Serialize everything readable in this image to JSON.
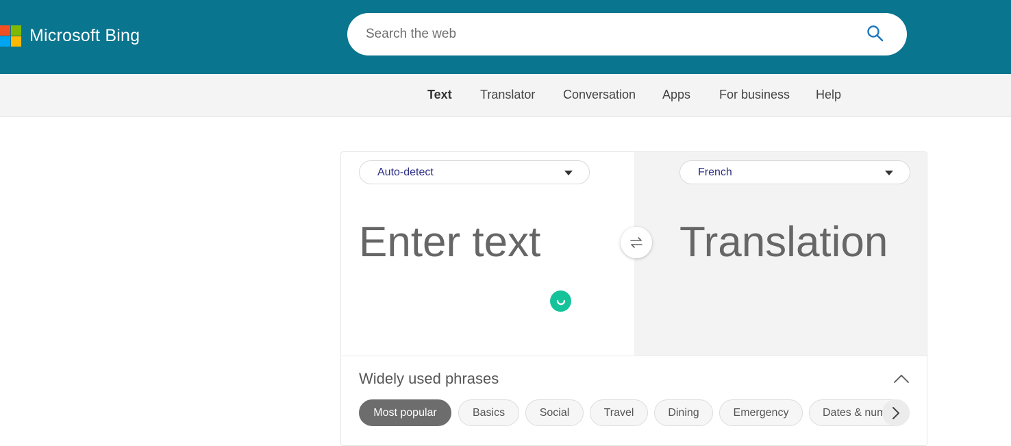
{
  "header": {
    "brand": "Microsoft Bing",
    "search": {
      "placeholder": "Search the web"
    },
    "colors": {
      "background": "#0a758f",
      "logo_red": "#f25022",
      "logo_green": "#7fba00",
      "logo_blue": "#00a4ef",
      "logo_yellow": "#ffb900"
    }
  },
  "subnav": {
    "items": [
      {
        "label": "Text",
        "active": true
      },
      {
        "label": "Translator"
      },
      {
        "label": "Conversation"
      },
      {
        "label": "Apps"
      },
      {
        "label": "For business"
      },
      {
        "label": "Help"
      }
    ]
  },
  "translator": {
    "source_language": "Auto-detect",
    "target_language": "French",
    "input_placeholder": "Enter text",
    "output_placeholder": "Translation",
    "swap_icon": "swap-arrows-icon"
  },
  "phrases": {
    "title": "Widely used phrases",
    "categories": [
      {
        "label": "Most popular",
        "active": true
      },
      {
        "label": "Basics"
      },
      {
        "label": "Social"
      },
      {
        "label": "Travel"
      },
      {
        "label": "Dining"
      },
      {
        "label": "Emergency"
      },
      {
        "label": "Dates & numbers"
      }
    ]
  }
}
